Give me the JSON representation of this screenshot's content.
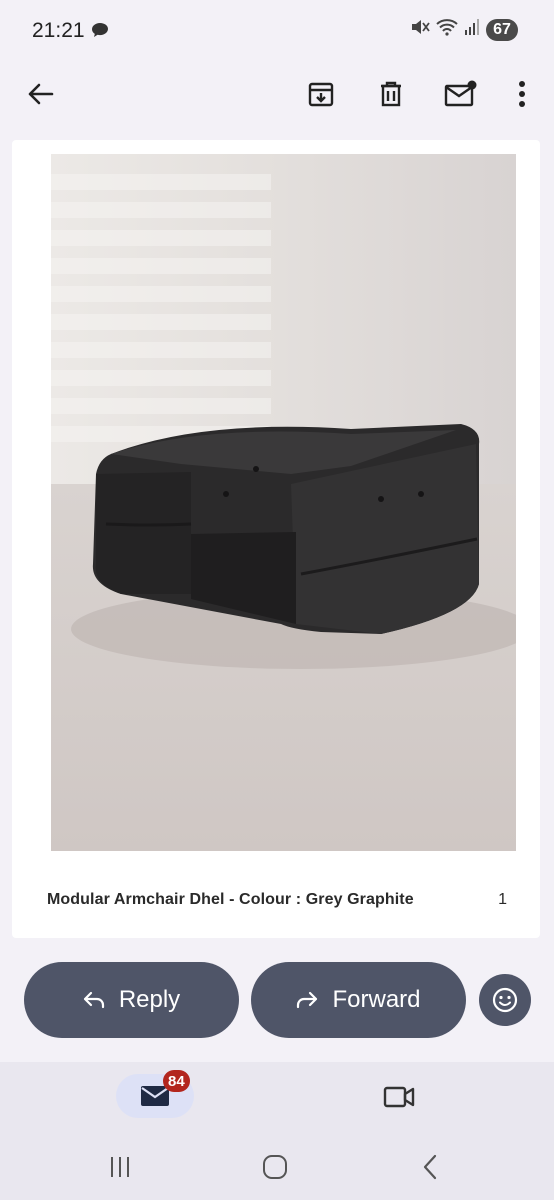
{
  "status_bar": {
    "time": "21:21",
    "battery": "67",
    "icons": [
      "chat-bubble-icon",
      "mute-icon",
      "wifi-icon",
      "signal-icon"
    ]
  },
  "toolbar": {
    "back_icon": "arrow-back-icon",
    "actions": [
      "archive-icon",
      "delete-icon",
      "mark-unread-icon",
      "more-vert-icon"
    ]
  },
  "product": {
    "name": "Modular Armchair Dhel - Colour : Grey Graphite",
    "quantity": "1"
  },
  "actions": {
    "reply_label": "Reply",
    "forward_label": "Forward",
    "emoji_icon": "emoji-react-icon"
  },
  "bottom_nav": {
    "mail_badge": "84",
    "items": [
      "mail-icon",
      "meet-video-icon"
    ]
  },
  "system_nav": [
    "recents-icon",
    "home-icon",
    "back-icon"
  ],
  "colors": {
    "background": "#f3f1f7",
    "button": "#4f5568",
    "badge": "#b3261e",
    "nav_highlight": "#dde1f6"
  }
}
